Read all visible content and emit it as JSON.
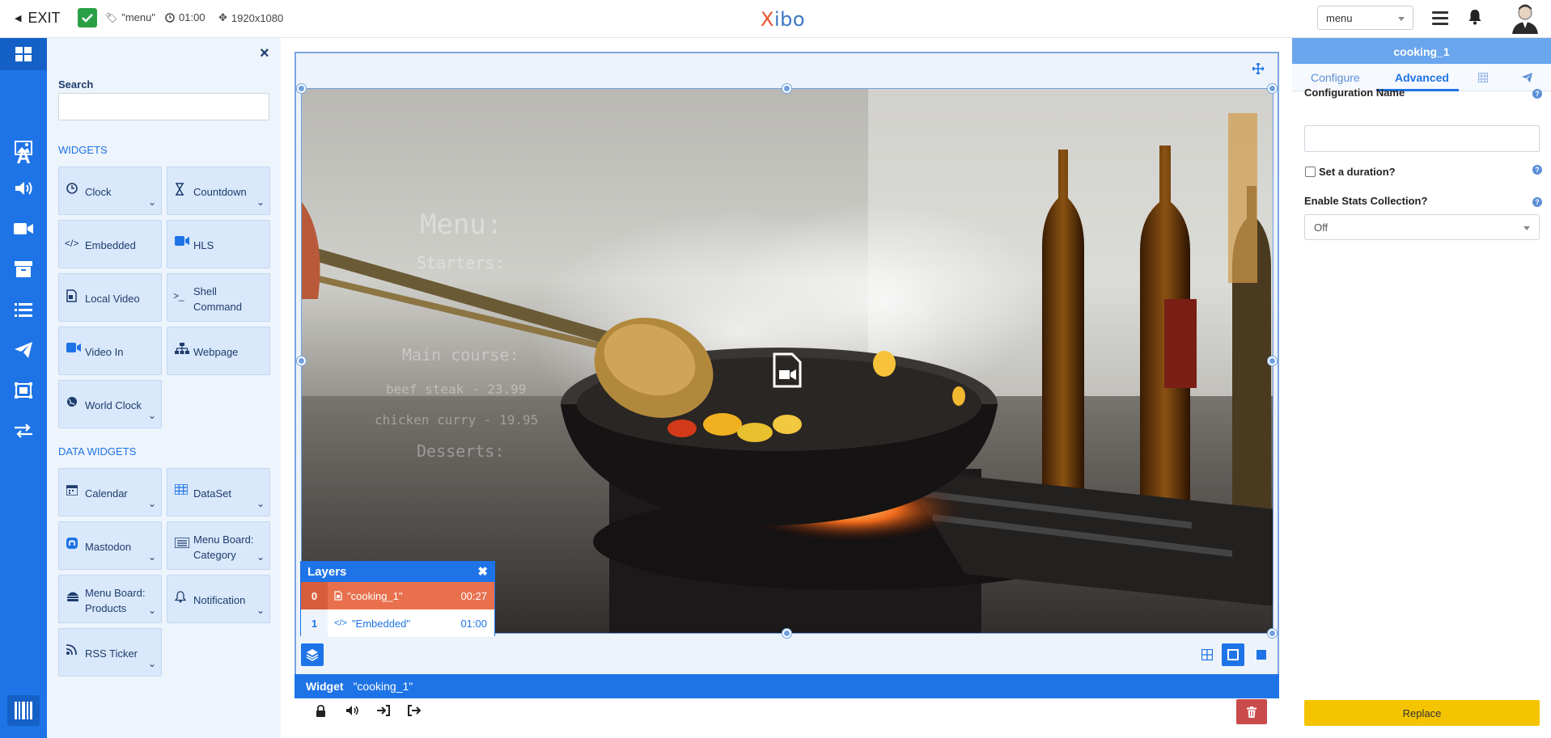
{
  "topbar": {
    "exit_label": "EXIT",
    "layout_name": "\"menu\"",
    "duration": "01:00",
    "resolution": "1920x1080",
    "logo_first": "X",
    "logo_rest": "ibo",
    "select_value": "menu"
  },
  "toolbox": {
    "search_label": "Search",
    "search_placeholder": "",
    "widgets_title": "WIDGETS",
    "data_widgets_title": "DATA WIDGETS",
    "widgets": [
      {
        "label": "Clock",
        "icon": "clock-icon"
      },
      {
        "label": "Countdown",
        "icon": "hourglass-icon"
      },
      {
        "label": "Embedded",
        "icon": "code-icon"
      },
      {
        "label": "HLS",
        "icon": "video-camera-icon"
      },
      {
        "label": "Local Video",
        "icon": "file-video-icon"
      },
      {
        "label": "Shell Command",
        "icon": "terminal-icon"
      },
      {
        "label": "Video In",
        "icon": "video-camera-icon"
      },
      {
        "label": "Webpage",
        "icon": "sitemap-icon"
      },
      {
        "label": "World Clock",
        "icon": "globe-icon"
      }
    ],
    "data_widgets": [
      {
        "label": "Calendar",
        "icon": "calendar-icon"
      },
      {
        "label": "DataSet",
        "icon": "table-icon"
      },
      {
        "label": "Mastodon",
        "icon": "mastodon-icon"
      },
      {
        "label": "Menu Board: Category",
        "icon": "list-board-icon"
      },
      {
        "label": "Menu Board: Products",
        "icon": "burger-icon"
      },
      {
        "label": "Notification",
        "icon": "bell-icon"
      },
      {
        "label": "RSS Ticker",
        "icon": "rss-icon"
      }
    ]
  },
  "canvas": {
    "overlay_text": [
      "Menu:",
      "Starters:",
      "",
      "Main course:",
      "beef steak - 23.99",
      "chicken curry - 19.95",
      "Desserts:",
      ""
    ]
  },
  "layers": {
    "title": "Layers",
    "rows": [
      {
        "index": "0",
        "name": "\"cooking_1\"",
        "duration": "00:27"
      },
      {
        "index": "1",
        "name": "\"Embedded\"",
        "duration": "01:00"
      }
    ]
  },
  "widget_bar": {
    "label": "Widget",
    "name": "\"cooking_1\""
  },
  "right_panel": {
    "title": "cooking_1",
    "tabs": [
      "Configure",
      "Advanced"
    ],
    "config_name_label": "Configuration Name",
    "config_name_value": "",
    "duration_label": "Set a duration?",
    "stats_label": "Enable Stats Collection?",
    "stats_value": "Off",
    "replace_label": "Replace"
  },
  "colors": {
    "accent": "#1e74e6",
    "layer_active": "#e8704d",
    "replace": "#f5c400",
    "delete": "#c94a4a"
  }
}
